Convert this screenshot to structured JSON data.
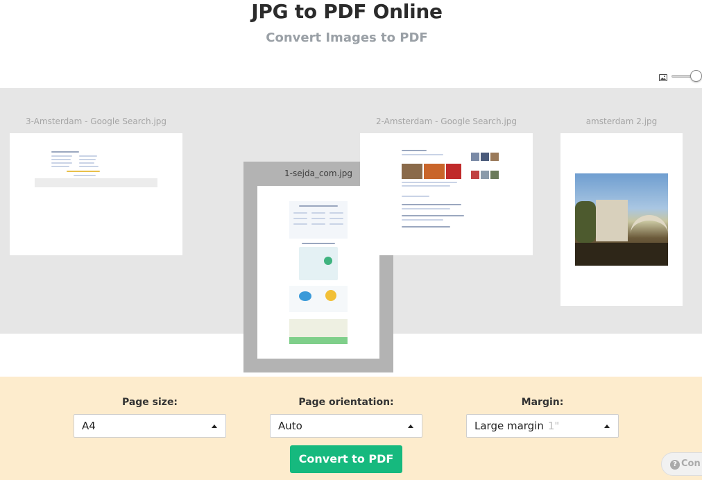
{
  "header": {
    "title": "JPG to PDF Online",
    "subtitle": "Convert Images to PDF"
  },
  "zoom": {
    "icon": "image-icon",
    "level": 1.0
  },
  "files": [
    {
      "name": "3-Amsterdam - Google Search.jpg"
    },
    {
      "name": "1-sejda_com.jpg"
    },
    {
      "name": "2-Amsterdam - Google Search.jpg"
    },
    {
      "name": "amsterdam 2.jpg"
    }
  ],
  "remove_icon": "close-icon",
  "remove_glyph": "✖",
  "options": {
    "page_size": {
      "label": "Page size:",
      "value": "A4"
    },
    "page_orientation": {
      "label": "Page orientation:",
      "value": "Auto"
    },
    "margin": {
      "label": "Margin:",
      "value": "Large margin",
      "hint": "1\""
    }
  },
  "convert_label": "Convert to PDF",
  "help": {
    "icon": "question-icon",
    "glyph": "?",
    "label": "Con"
  },
  "colors": {
    "accent": "#16b97e",
    "options_bg": "#fdeccd",
    "workspace_bg": "#e6e6e6",
    "remove_blue": "#2a7fd4"
  }
}
